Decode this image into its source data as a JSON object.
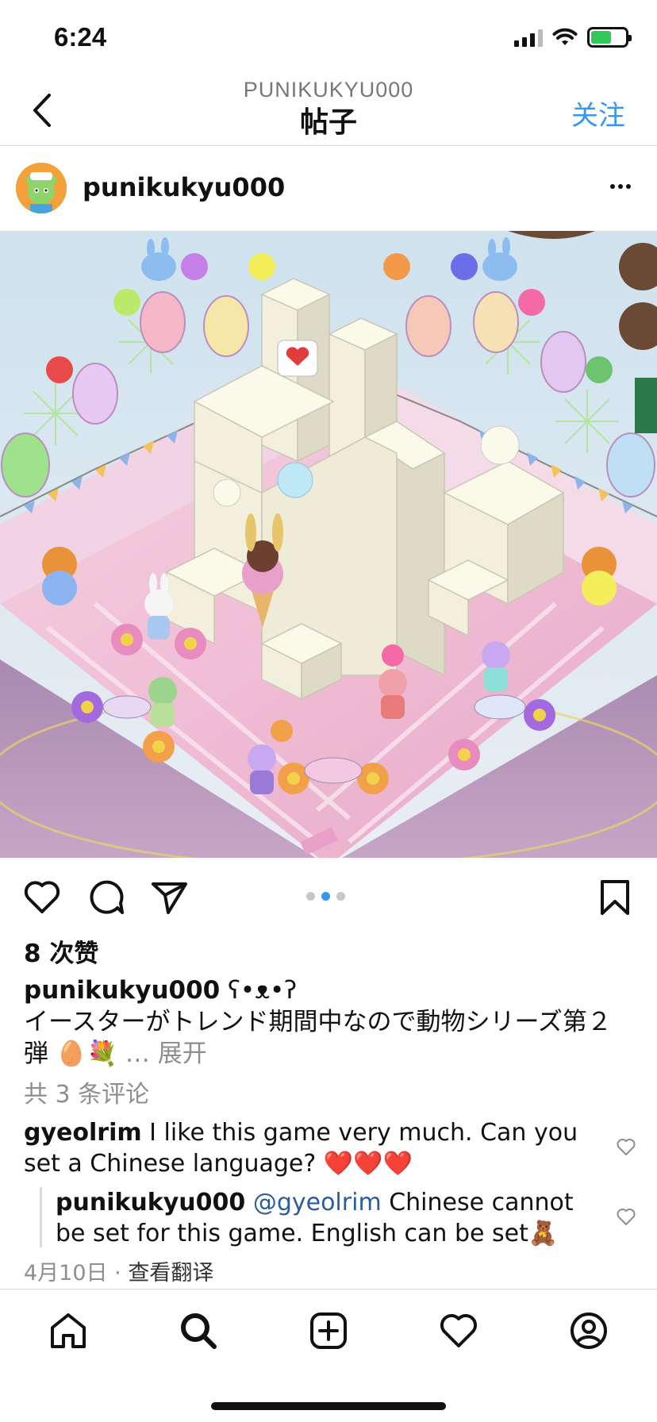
{
  "status": {
    "time": "6:24"
  },
  "header": {
    "subtitle": "PUNIKUKYU000",
    "title": "帖子",
    "follow": "关注"
  },
  "post": {
    "username": "punikukyu000",
    "image_slides": {
      "count": 3,
      "active": 2
    },
    "likes": "8 次赞",
    "caption_user": "punikukyu000",
    "caption_user_suffix": " ʕ•ᴥ•ʔ",
    "caption_text": "イースターがトレンド期間中なので動物シリーズ第２弾",
    "caption_emoji": "🥚💐",
    "caption_more": "… 展开",
    "comments_count": "共 3 条评论",
    "comments": [
      {
        "user": "gyeolrim",
        "text": "I like this game very much. Can you set a Chinese language?",
        "emoji": "❤️❤️❤️"
      },
      {
        "user": "punikukyu000",
        "mention": "@gyeolrim",
        "text": "Chinese cannot be set for this game.  English can be set",
        "emoji": "🧸"
      }
    ],
    "date": "4月10日",
    "separator": "·",
    "translate": "查看翻译"
  },
  "icons": {
    "back": "chevron-left-icon",
    "more": "more-horizontal-icon",
    "like": "heart-icon",
    "comment": "comment-icon",
    "share": "send-icon",
    "save": "bookmark-icon",
    "home": "home-icon",
    "search": "search-icon",
    "create": "add-square-icon",
    "activity": "heart-icon",
    "profile": "profile-icon"
  },
  "colors": {
    "link": "#3797f0",
    "muted": "#8e8e8e",
    "mention": "#2a5d9c"
  }
}
